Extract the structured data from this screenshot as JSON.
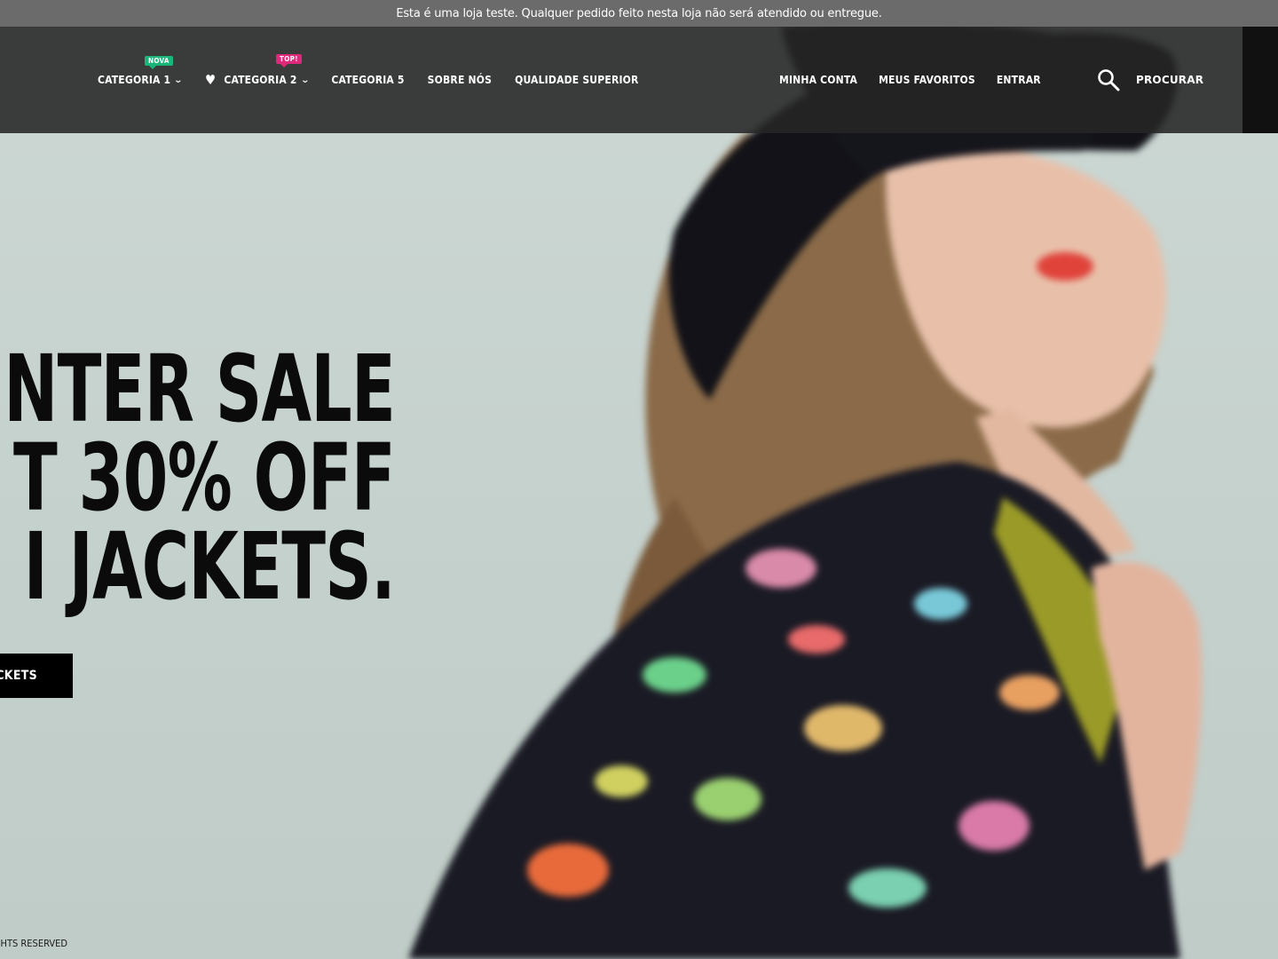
{
  "notice": {
    "text": "Esta é uma loja teste. Qualquer pedido feito nesta loja não será atendido ou entregue."
  },
  "nav": {
    "left": [
      {
        "label": "CATEGORIA 1",
        "badge": "NOVA",
        "badge_color": "#1bb57a"
      },
      {
        "label": "CATEGORIA 2",
        "badge": "TOP!",
        "badge_color": "#e0287a",
        "icon": "heart-icon"
      },
      {
        "label": "CATEGORIA 5"
      },
      {
        "label": "SOBRE NÓS"
      },
      {
        "label": "QUALIDADE SUPERIOR"
      }
    ],
    "right": [
      {
        "label": "MINHA CONTA"
      },
      {
        "label": "MEUS FAVORITOS"
      },
      {
        "label": "ENTRAR"
      }
    ],
    "search": {
      "label": "PROCURAR",
      "icon": "search-icon"
    }
  },
  "hero": {
    "lines": [
      "NTER SALE",
      "T 30% OFF",
      "I JACKETS."
    ],
    "cta_label": "ACKETS",
    "copyright": "GHTS RESERVED."
  },
  "colors": {
    "notice_bg": "#6b6b6b",
    "header_bg": "#262626",
    "cta_bg": "#000000",
    "hero_bg": "#c9d4d0"
  }
}
